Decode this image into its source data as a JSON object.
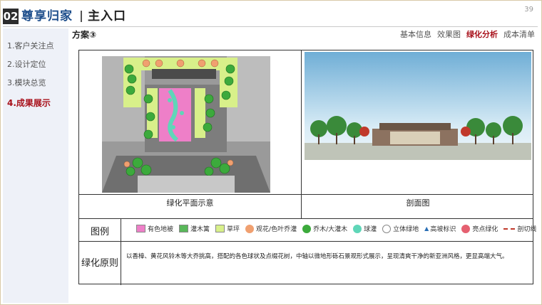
{
  "header": {
    "number": "02",
    "title": "尊享归家",
    "subtitle": "主入口",
    "page": "39"
  },
  "sidebar": {
    "items": [
      {
        "label": "1.客户关注点"
      },
      {
        "label": "2.设计定位"
      },
      {
        "label": "3.模块总览"
      },
      {
        "label": "4.成果展示"
      }
    ],
    "active_index": 3
  },
  "scheme_title": "方案③",
  "tabs": [
    {
      "label": "基本信息"
    },
    {
      "label": "效果图"
    },
    {
      "label": "绿化分析"
    },
    {
      "label": "成本清单"
    }
  ],
  "active_tab_index": 2,
  "table": {
    "plan_caption": "绿化平面示意",
    "section_caption": "剖面图",
    "legend_label": "图例",
    "legend_items": [
      {
        "label": "有色地被",
        "icon": "pink-square",
        "color": "#ee7fc8"
      },
      {
        "label": "灌木篱",
        "icon": "green-square",
        "color": "#59b85a"
      },
      {
        "label": "草坪",
        "icon": "lightgreen-square",
        "color": "#d8f08a"
      },
      {
        "label": "观花/色叶乔灌",
        "icon": "orange-circle",
        "color": "#f0a070"
      },
      {
        "label": "乔木/大灌木",
        "icon": "green-circle",
        "color": "#3caa3c"
      },
      {
        "label": "球灌",
        "icon": "teal-circle",
        "color": "#5fd6b8"
      },
      {
        "label": "立体绿地",
        "icon": "white-circle",
        "color": "#ffffff"
      },
      {
        "label": "高坡标识",
        "icon": "triangle-icon",
        "color": "#2a6fb5"
      },
      {
        "label": "亮点绿化",
        "icon": "red-circle",
        "color": "#e56070"
      },
      {
        "label": "剖切线",
        "icon": "dash-line",
        "color": "#c0392b"
      }
    ],
    "principle_label": "绿化原则",
    "principle_text": "以香樟、黄花风铃木等大乔挑高，搭配的各色球状及点缀花树，中轴以微地形砾石景观形式展示，呈现清爽干净的新亚洲风格，更显高端大气。"
  },
  "colors": {
    "title_blue": "#1f4f8c",
    "active_red": "#a8111b",
    "sidebar_bg": "#eef1f8"
  }
}
